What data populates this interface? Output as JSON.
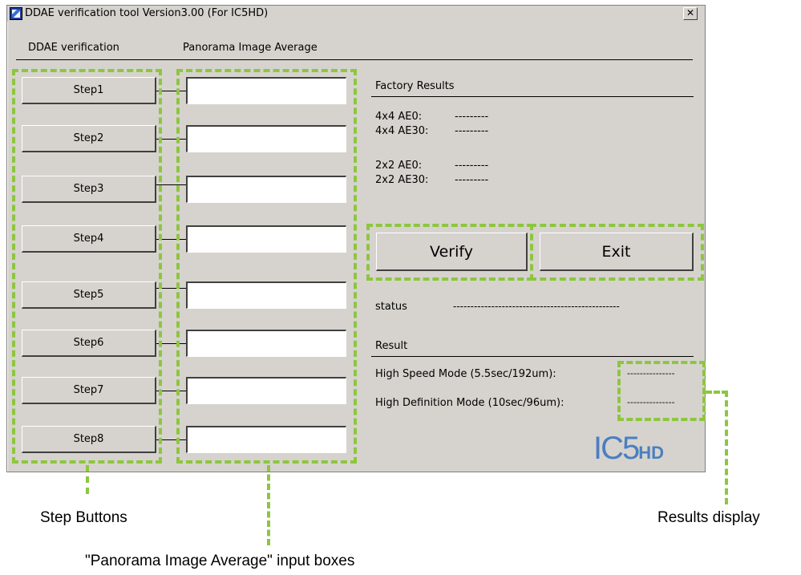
{
  "window": {
    "title": "DDAE verification tool Version3.00 (For IC5HD)",
    "close_glyph": "✕"
  },
  "tabs": [
    {
      "label": "DDAE verification"
    },
    {
      "label": "Panorama Image Average"
    }
  ],
  "steps": [
    {
      "label": "Step1",
      "value": ""
    },
    {
      "label": "Step2",
      "value": ""
    },
    {
      "label": "Step3",
      "value": ""
    },
    {
      "label": "Step4",
      "value": ""
    },
    {
      "label": "Step5",
      "value": ""
    },
    {
      "label": "Step6",
      "value": ""
    },
    {
      "label": "Step7",
      "value": ""
    },
    {
      "label": "Step8",
      "value": ""
    }
  ],
  "factory": {
    "heading": "Factory Results",
    "rows": [
      {
        "label": "4x4 AE0:",
        "value": "---------"
      },
      {
        "label": "4x4 AE30:",
        "value": "---------"
      },
      {
        "label": "2x2 AE0:",
        "value": "---------"
      },
      {
        "label": "2x2 AE30:",
        "value": "---------"
      }
    ]
  },
  "actions": {
    "verify_label": "Verify",
    "exit_label": "Exit"
  },
  "status": {
    "label": "status",
    "value": "------------------------------------------------"
  },
  "result": {
    "heading": "Result",
    "high_speed_label": "High Speed Mode  (5.5sec/192um):",
    "high_speed_value": "---------------",
    "high_def_label": "High Definition Mode  (10sec/96um):",
    "high_def_value": "---------------"
  },
  "logo": {
    "text": "IC5",
    "suffix": "HD"
  },
  "annotations": {
    "step_buttons": "Step Buttons",
    "input_boxes": "\"Panorama Image Average\" input boxes",
    "results_display": "Results display"
  },
  "colors": {
    "window_bg": "#d6d3ce",
    "annotation_green": "#8dc63f",
    "logo_blue": "#4a7fc1"
  }
}
